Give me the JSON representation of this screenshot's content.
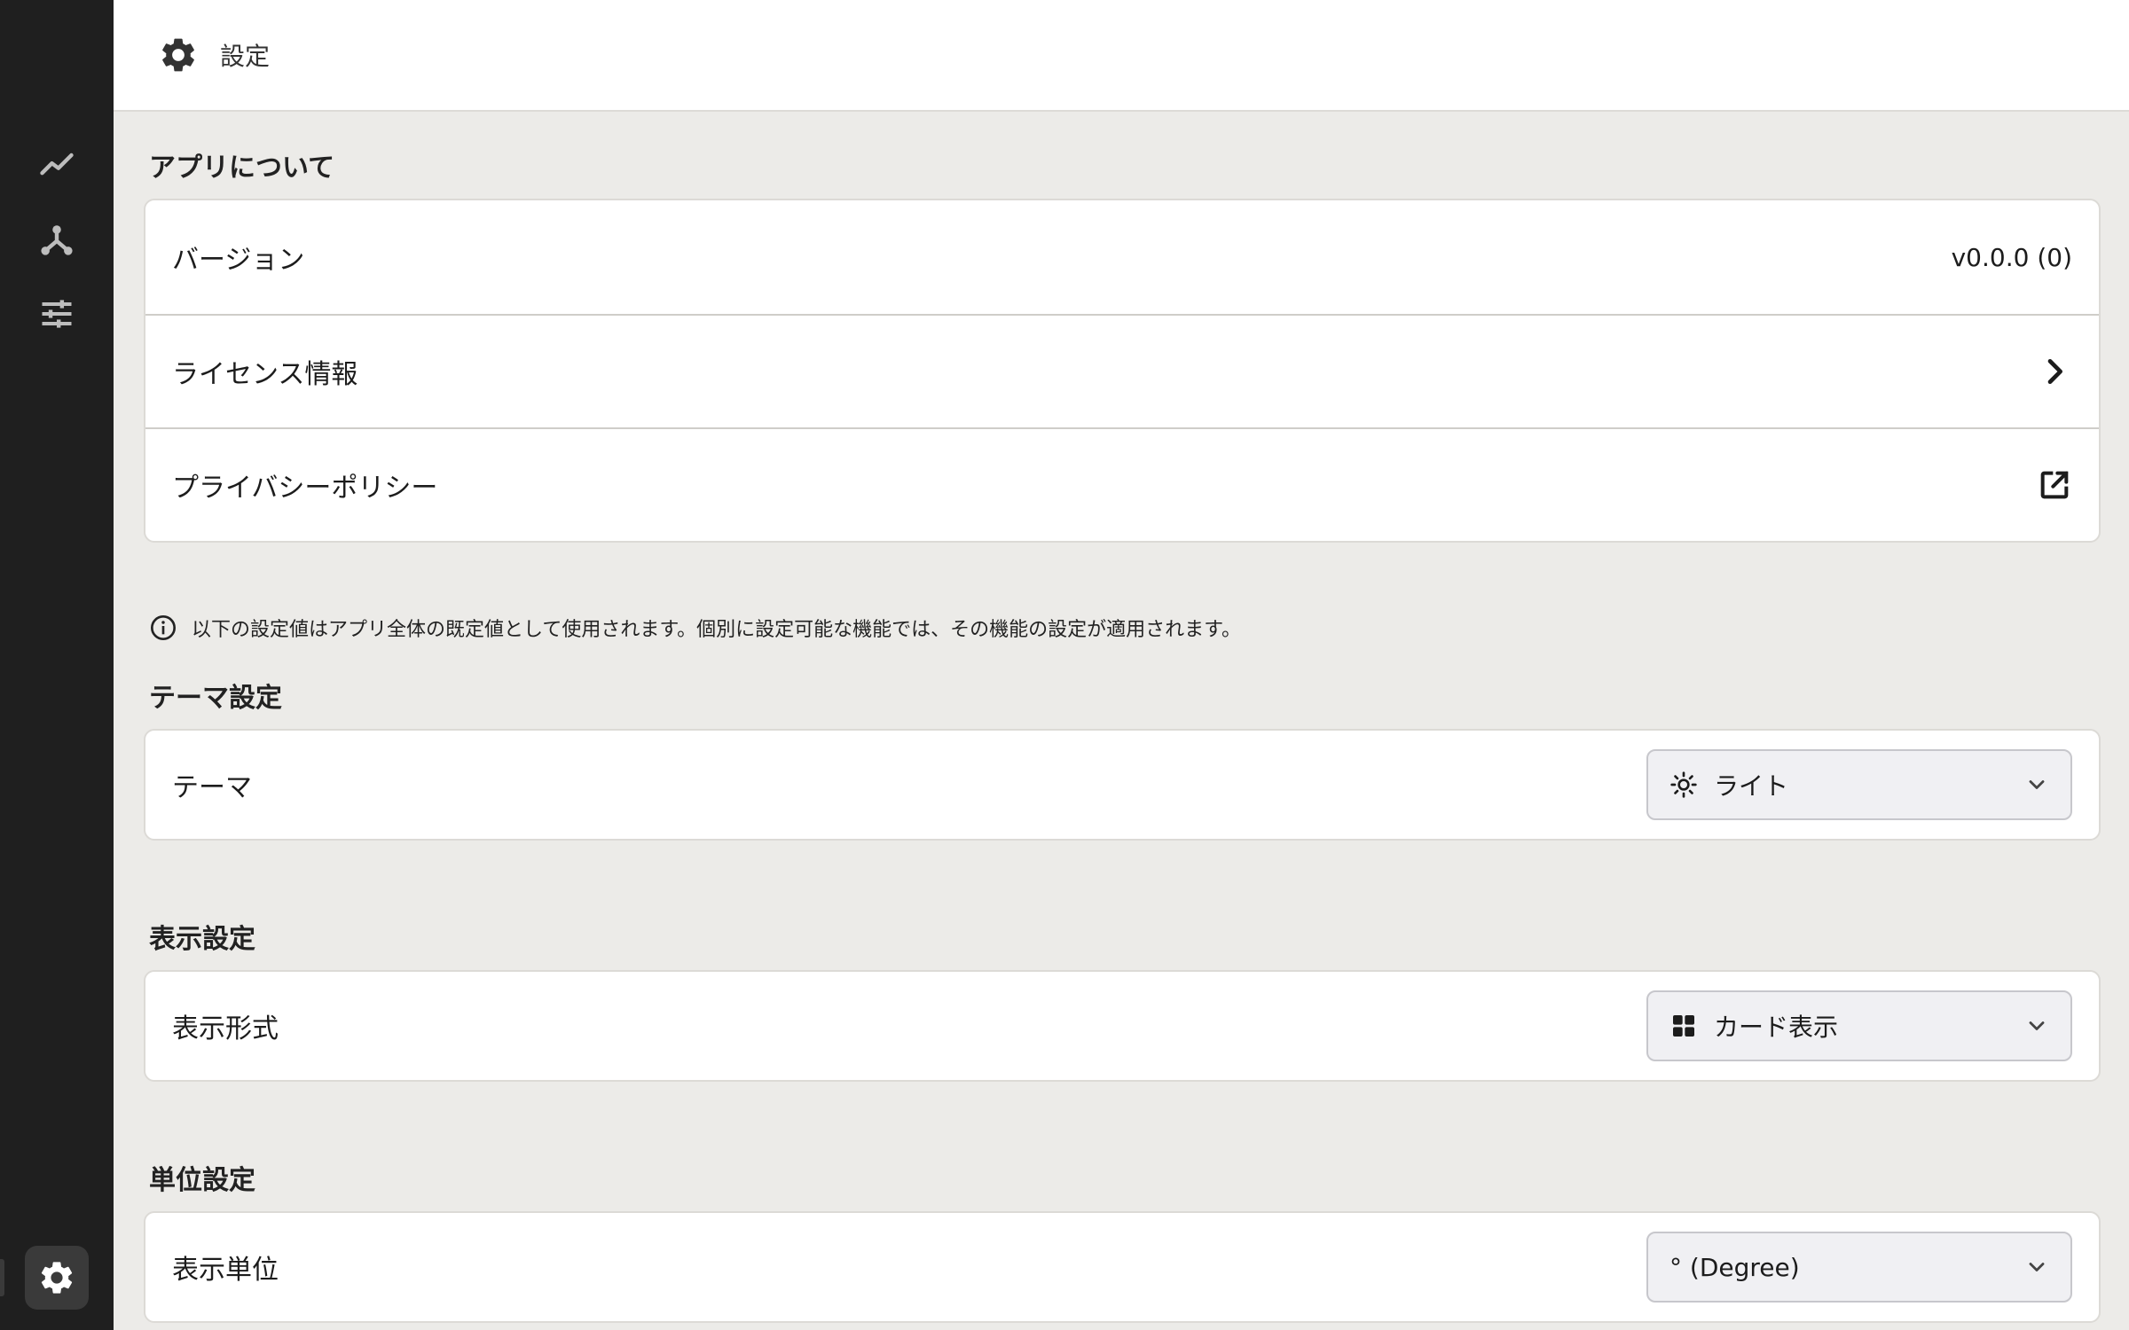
{
  "header": {
    "title": "設定",
    "icon": "gear-icon"
  },
  "sidebar": {
    "items": [
      {
        "name": "chart-icon",
        "label": ""
      },
      {
        "name": "network-icon",
        "label": ""
      },
      {
        "name": "sliders-icon",
        "label": ""
      }
    ],
    "settings_icon": "gear-icon"
  },
  "about": {
    "title": "アプリについて",
    "version_label": "バージョン",
    "version_value": "v0.0.0 (0)",
    "license_label": "ライセンス情報",
    "privacy_label": "プライバシーポリシー"
  },
  "notice": "以下の設定値はアプリ全体の既定値として使用されます。個別に設定可能な機能では、その機能の設定が適用されます。",
  "theme": {
    "title": "テーマ設定",
    "label": "テーマ",
    "selected": "ライト",
    "icon": "sun-icon"
  },
  "display": {
    "title": "表示設定",
    "label": "表示形式",
    "selected": "カード表示",
    "icon": "grid-icon"
  },
  "units": {
    "title": "単位設定",
    "label": "表示単位",
    "selected": "° (Degree)"
  },
  "colors": {
    "sidebar": "#1f1f1f",
    "background": "#ecebe8",
    "card": "#ffffff"
  }
}
